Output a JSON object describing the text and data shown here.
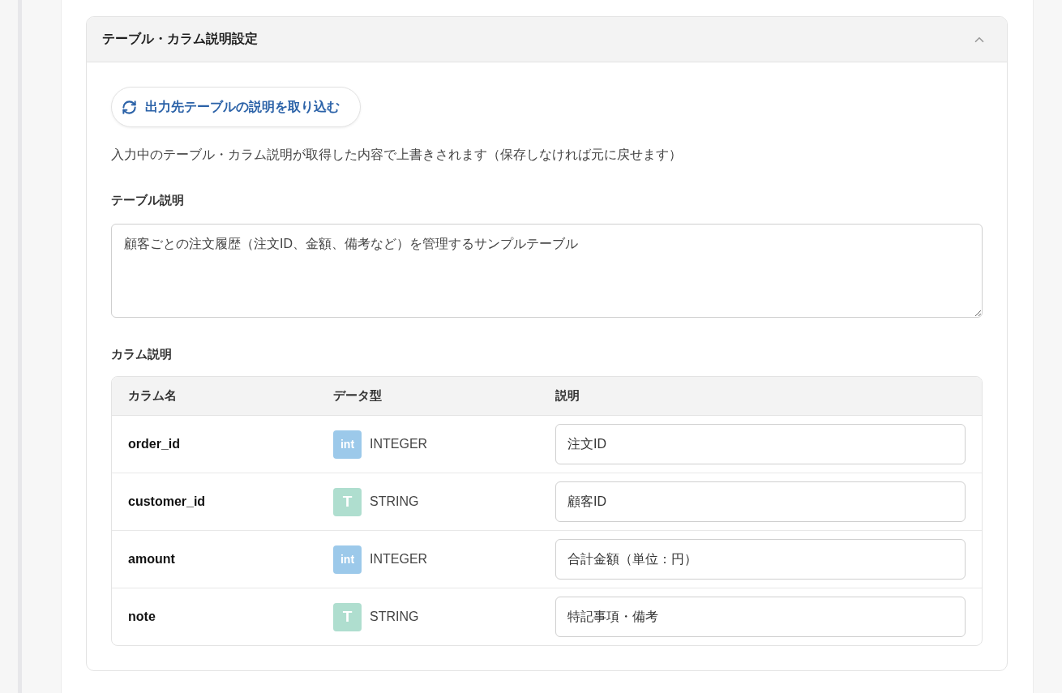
{
  "section": {
    "title": "テーブル・カラム説明設定",
    "expanded": true
  },
  "import_button": {
    "label": "出力先テーブルの説明を取り込む"
  },
  "notice": "入力中のテーブル・カラム説明が取得した内容で上書きされます（保存しなければ元に戻せます）",
  "table_description": {
    "label": "テーブル説明",
    "value": "顧客ごとの注文履歴（注文ID、金額、備考など）を管理するサンプルテーブル"
  },
  "column_description": {
    "label": "カラム説明",
    "columns": [
      "カラム名",
      "データ型",
      "説明"
    ],
    "rows": [
      {
        "name": "order_id",
        "kind": "int",
        "badge": "int",
        "type": "INTEGER",
        "description": "注文ID"
      },
      {
        "name": "customer_id",
        "kind": "string",
        "badge": "T",
        "type": "STRING",
        "description": "顧客ID"
      },
      {
        "name": "amount",
        "kind": "int",
        "badge": "int",
        "type": "INTEGER",
        "description": "合計金額（単位：円）"
      },
      {
        "name": "note",
        "kind": "string",
        "badge": "T",
        "type": "STRING",
        "description": "特記事項・備考"
      }
    ]
  }
}
